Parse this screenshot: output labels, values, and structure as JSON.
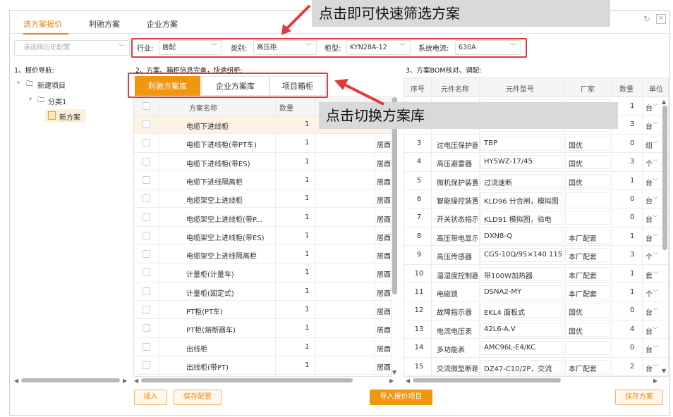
{
  "tabs": [
    {
      "label": "选方案报价"
    },
    {
      "label": "利驰方案"
    },
    {
      "label": "企业方案"
    }
  ],
  "annotations": {
    "filter_hint": "点击即可快速筛选方案",
    "library_hint": "点击切换方案库"
  },
  "history": {
    "placeholder": "请选择历史配置"
  },
  "filters": {
    "industry_label": "行业:",
    "industry_value": "居配",
    "category_label": "类别:",
    "category_value": "高压柜",
    "cabinet_label": "柜型:",
    "cabinet_value": "KYN28A-12",
    "current_label": "系统电流:",
    "current_value": "630A"
  },
  "sections": {
    "nav": "1、报价导航:",
    "scheme": "2、方案、箱柜信息完善，快速组柜:",
    "bom": "3、方案BOM核对、调配:"
  },
  "tree": {
    "root": "新建项目",
    "cat": "分类1",
    "leaf": "新方案"
  },
  "lib_tabs": [
    {
      "label": "利驰方案库"
    },
    {
      "label": "企业方案库"
    },
    {
      "label": "项目箱柜"
    }
  ],
  "scheme_grid": {
    "headers": {
      "name": "方案名称",
      "qty": "数量"
    },
    "rows": [
      {
        "name": "电缆下进线柜",
        "qty": "1",
        "extra": ""
      },
      {
        "name": "电缆下进线柜(带PT车)",
        "qty": "1",
        "extra": "居酉"
      },
      {
        "name": "电缆下进线柜(带ES)",
        "qty": "1",
        "extra": "居酉"
      },
      {
        "name": "电缆下进线隔离柜",
        "qty": "1",
        "extra": "居酉"
      },
      {
        "name": "电缆架空上进线柜",
        "qty": "1",
        "extra": "居酉"
      },
      {
        "name": "电缆架空上进线柜(带P...",
        "qty": "1",
        "extra": "居酉"
      },
      {
        "name": "电缆架空上进线柜(带ES)",
        "qty": "1",
        "extra": "居酉"
      },
      {
        "name": "电缆架空上进线隔离柜",
        "qty": "1",
        "extra": "居酉"
      },
      {
        "name": "计量柜(计量车)",
        "qty": "1",
        "extra": "居酉"
      },
      {
        "name": "计量柜(固定式)",
        "qty": "1",
        "extra": "居酉"
      },
      {
        "name": "PT柜(PT车)",
        "qty": "1",
        "extra": "居酉"
      },
      {
        "name": "PT柜(熔断器车)",
        "qty": "1",
        "extra": "居酉"
      },
      {
        "name": "出线柜",
        "qty": "1",
        "extra": "居酉"
      },
      {
        "name": "出线柜(带PT)",
        "qty": "1",
        "extra": "居酉"
      }
    ]
  },
  "bom_grid": {
    "headers": {
      "no": "序号",
      "comp": "元件名称",
      "model": "元件型号",
      "vendor": "厂家",
      "qty": "数量",
      "unit": "单位"
    },
    "rows": [
      {
        "no": "",
        "comp": "",
        "model": "",
        "vendor": "",
        "qty": "1",
        "unit": "台"
      },
      {
        "no": "",
        "comp": "",
        "model": "",
        "vendor": "",
        "qty": "3",
        "unit": "台"
      },
      {
        "no": "3",
        "comp": "过电压保护器",
        "model": "TBP",
        "vendor": "国优",
        "qty": "0",
        "unit": "组"
      },
      {
        "no": "4",
        "comp": "高压避雷器",
        "model": "HY5WZ-17/45",
        "vendor": "国优",
        "qty": "3",
        "unit": "个"
      },
      {
        "no": "5",
        "comp": "微机保护装置",
        "model": "过流速断",
        "vendor": "国优",
        "qty": "1",
        "unit": "台"
      },
      {
        "no": "6",
        "comp": "智能操控装置",
        "model": "KLD96 分合闸，模拟图",
        "vendor": "",
        "qty": "0",
        "unit": "台"
      },
      {
        "no": "7",
        "comp": "开关状态指示",
        "model": "KLD91 模拟图，验电",
        "vendor": "",
        "qty": "0",
        "unit": "台"
      },
      {
        "no": "8",
        "comp": "高压带电显示",
        "model": "DXN8-Q",
        "vendor": "本厂配套",
        "qty": "1",
        "unit": "台"
      },
      {
        "no": "9",
        "comp": "高压传感器",
        "model": "CG5-10Q/95×140 115",
        "vendor": "本厂配套",
        "qty": "3",
        "unit": "个"
      },
      {
        "no": "10",
        "comp": "温湿度控制器",
        "model": "带100W加热器",
        "vendor": "本厂配套",
        "qty": "1",
        "unit": "套"
      },
      {
        "no": "11",
        "comp": "电磁锁",
        "model": "DSNA2-MY",
        "vendor": "本厂配套",
        "qty": "1",
        "unit": "个"
      },
      {
        "no": "12",
        "comp": "故障指示器",
        "model": "EKL4 面板式",
        "vendor": "国优",
        "qty": "0",
        "unit": "台"
      },
      {
        "no": "13",
        "comp": "电流电压表",
        "model": "42L6-A.V",
        "vendor": "国优",
        "qty": "4",
        "unit": "台"
      },
      {
        "no": "14",
        "comp": "多功能表",
        "model": "AMC96L-E4/KC",
        "vendor": "",
        "qty": "0",
        "unit": "台"
      },
      {
        "no": "15",
        "comp": "交流微型断路器",
        "model": "DZ47-C10/2P，交流",
        "vendor": "本厂配套",
        "qty": "2",
        "unit": "台"
      }
    ]
  },
  "buttons": {
    "insert": "插入",
    "save_config": "保存配置",
    "import": "导入报价项目",
    "save_scheme": "保存方案"
  }
}
